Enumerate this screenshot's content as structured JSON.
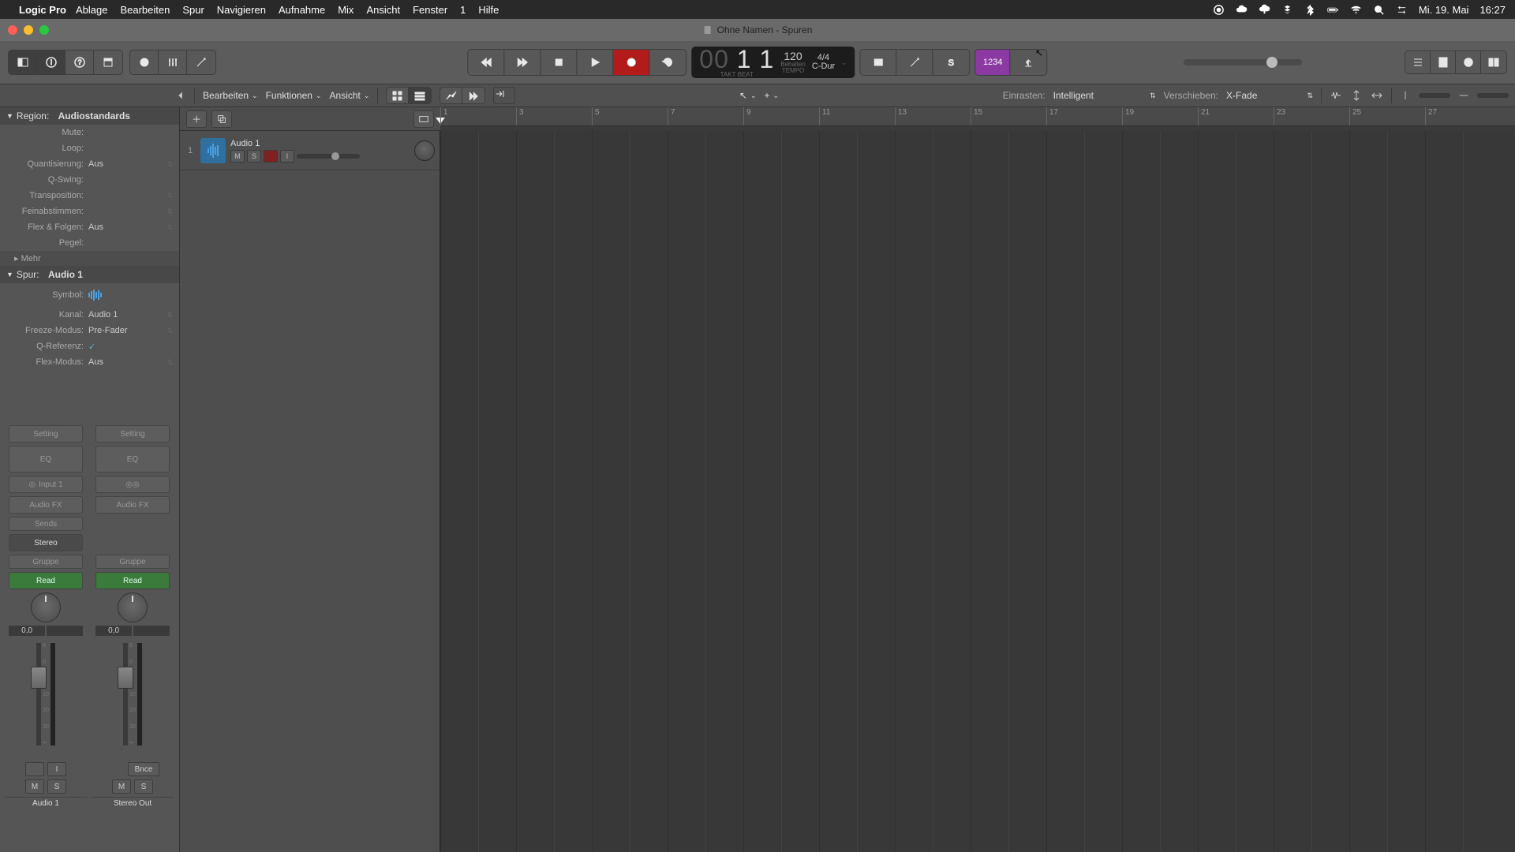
{
  "menubar": {
    "app_name": "Logic Pro",
    "menus": [
      "Ablage",
      "Bearbeiten",
      "Spur",
      "Navigieren",
      "Aufnahme",
      "Mix",
      "Ansicht",
      "Fenster",
      "1",
      "Hilfe"
    ],
    "date": "Mi. 19. Mai",
    "time": "16:27"
  },
  "window": {
    "title": "Ohne Namen - Spuren"
  },
  "lcd": {
    "bars_dim": "00",
    "bars": "1 1",
    "bars_sub": "TAKT           BEAT",
    "tempo": "120",
    "tempo_sub": "Behalten\nTEMPO",
    "sig": "4/4",
    "key": "C-Dur"
  },
  "count_in": "1234",
  "sub_toolbar": {
    "bearbeiten": "Bearbeiten",
    "funktionen": "Funktionen",
    "ansicht": "Ansicht",
    "einrasten_lbl": "Einrasten:",
    "einrasten_val": "Intelligent",
    "verschieben_lbl": "Verschieben:",
    "verschieben_val": "X-Fade"
  },
  "inspector": {
    "region_hdr": "Region:",
    "region_name": "Audiostandards",
    "rows": {
      "mute": {
        "l": "Mute:",
        "v": ""
      },
      "loop": {
        "l": "Loop:",
        "v": ""
      },
      "quant": {
        "l": "Quantisierung:",
        "v": "Aus"
      },
      "qswing": {
        "l": "Q-Swing:",
        "v": ""
      },
      "transp": {
        "l": "Transposition:",
        "v": ""
      },
      "fein": {
        "l": "Feinabstimmen:",
        "v": ""
      },
      "flex": {
        "l": "Flex & Folgen:",
        "v": "Aus"
      },
      "pegel": {
        "l": "Pegel:",
        "v": ""
      }
    },
    "mehr": "Mehr",
    "spur_hdr": "Spur:",
    "spur_name": "Audio 1",
    "spur_rows": {
      "symbol": {
        "l": "Symbol:"
      },
      "kanal": {
        "l": "Kanal:",
        "v": "Audio 1"
      },
      "freeze": {
        "l": "Freeze-Modus:",
        "v": "Pre-Fader"
      },
      "qref": {
        "l": "Q-Referenz:",
        "v": "✓"
      },
      "flexm": {
        "l": "Flex-Modus:",
        "v": "Aus"
      }
    }
  },
  "strip": {
    "setting": "Setting",
    "eq": "EQ",
    "input1": "Input 1",
    "audiofx": "Audio FX",
    "sends": "Sends",
    "stereo": "Stereo",
    "gruppe": "Gruppe",
    "read": "Read",
    "db": "0,0",
    "bnce": "Bnce",
    "m": "M",
    "s": "S",
    "i": "I",
    "name1": "Audio 1",
    "name2": "Stereo Out"
  },
  "track": {
    "num": "1",
    "name": "Audio 1",
    "m": "M",
    "s": "S",
    "r": "R",
    "i": "I"
  },
  "ruler": {
    "bars": [
      1,
      3,
      5,
      7,
      9,
      11,
      13,
      15,
      17,
      19,
      21,
      23,
      25,
      27
    ]
  }
}
